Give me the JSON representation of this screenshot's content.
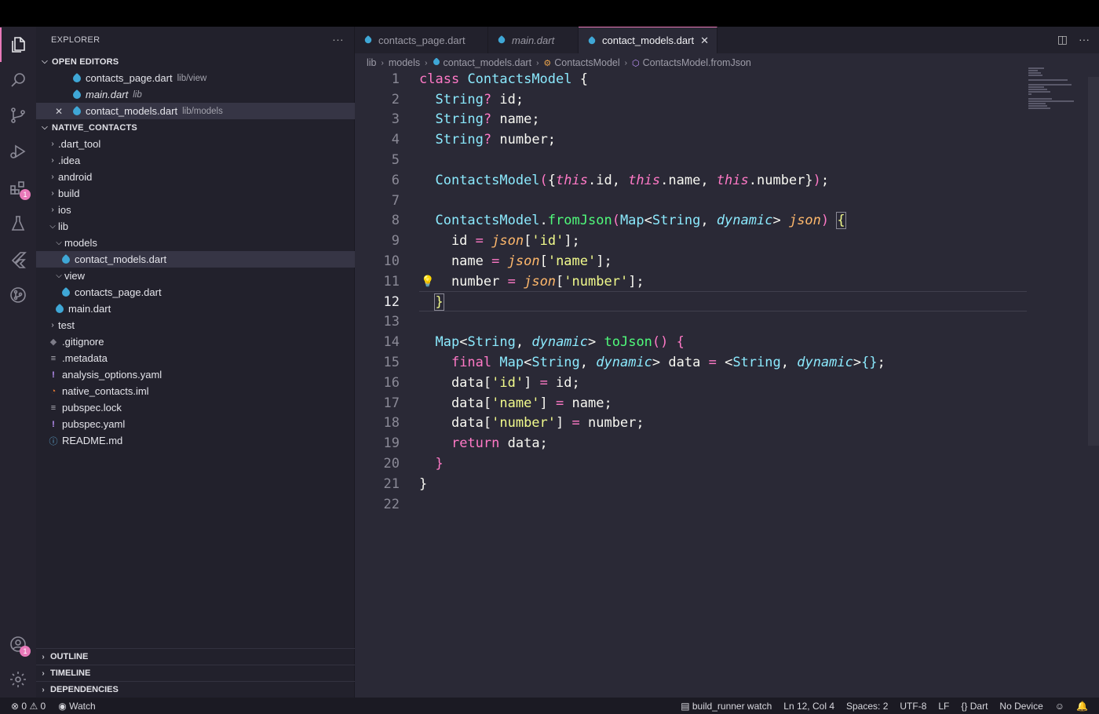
{
  "sidebar": {
    "title": "EXPLORER",
    "more": "···",
    "open_editors": {
      "title": "OPEN EDITORS",
      "items": [
        {
          "name": "contacts_page.dart",
          "path": "lib/view"
        },
        {
          "name": "main.dart",
          "path": "lib"
        },
        {
          "name": "contact_models.dart",
          "path": "lib/models",
          "close": "✕"
        }
      ]
    },
    "project": {
      "title": "NATIVE_CONTACTS",
      "items": [
        {
          "label": ".dart_tool"
        },
        {
          "label": ".idea"
        },
        {
          "label": "android"
        },
        {
          "label": "build"
        },
        {
          "label": "ios"
        },
        {
          "label": "lib"
        },
        {
          "label": "models"
        },
        {
          "label": "contact_models.dart"
        },
        {
          "label": "view"
        },
        {
          "label": "contacts_page.dart"
        },
        {
          "label": "main.dart"
        },
        {
          "label": "test"
        },
        {
          "label": ".gitignore"
        },
        {
          "label": ".metadata"
        },
        {
          "label": "analysis_options.yaml"
        },
        {
          "label": "native_contacts.iml"
        },
        {
          "label": "pubspec.lock"
        },
        {
          "label": "pubspec.yaml"
        },
        {
          "label": "README.md"
        }
      ]
    },
    "bottom_sections": [
      "OUTLINE",
      "TIMELINE",
      "DEPENDENCIES"
    ]
  },
  "activity_bar": {
    "badges": {
      "extensions": "1",
      "accounts": "1"
    }
  },
  "tabs": [
    {
      "label": "contacts_page.dart"
    },
    {
      "label": "main.dart"
    },
    {
      "label": "contact_models.dart",
      "close": "✕"
    }
  ],
  "breadcrumb": [
    "lib",
    "models",
    "contact_models.dart",
    "ContactsModel",
    "ContactsModel.fromJson"
  ],
  "editor": {
    "current_line": "12",
    "line_numbers": [
      "1",
      "2",
      "3",
      "4",
      "5",
      "6",
      "7",
      "8",
      "9",
      "10",
      "11",
      "12",
      "13",
      "14",
      "15",
      "16",
      "17",
      "18",
      "19",
      "20",
      "21",
      "22"
    ]
  },
  "status_bar": {
    "errors": "0",
    "warnings": "0",
    "watch": "Watch",
    "build_runner": "build_runner watch",
    "cursor": "Ln 12, Col 4",
    "spaces": "Spaces: 2",
    "encoding": "UTF-8",
    "eol": "LF",
    "language": "Dart",
    "device": "No Device"
  },
  "colors": {
    "accent": "#e879b9",
    "statusbar_bg": "#1b1a23"
  }
}
